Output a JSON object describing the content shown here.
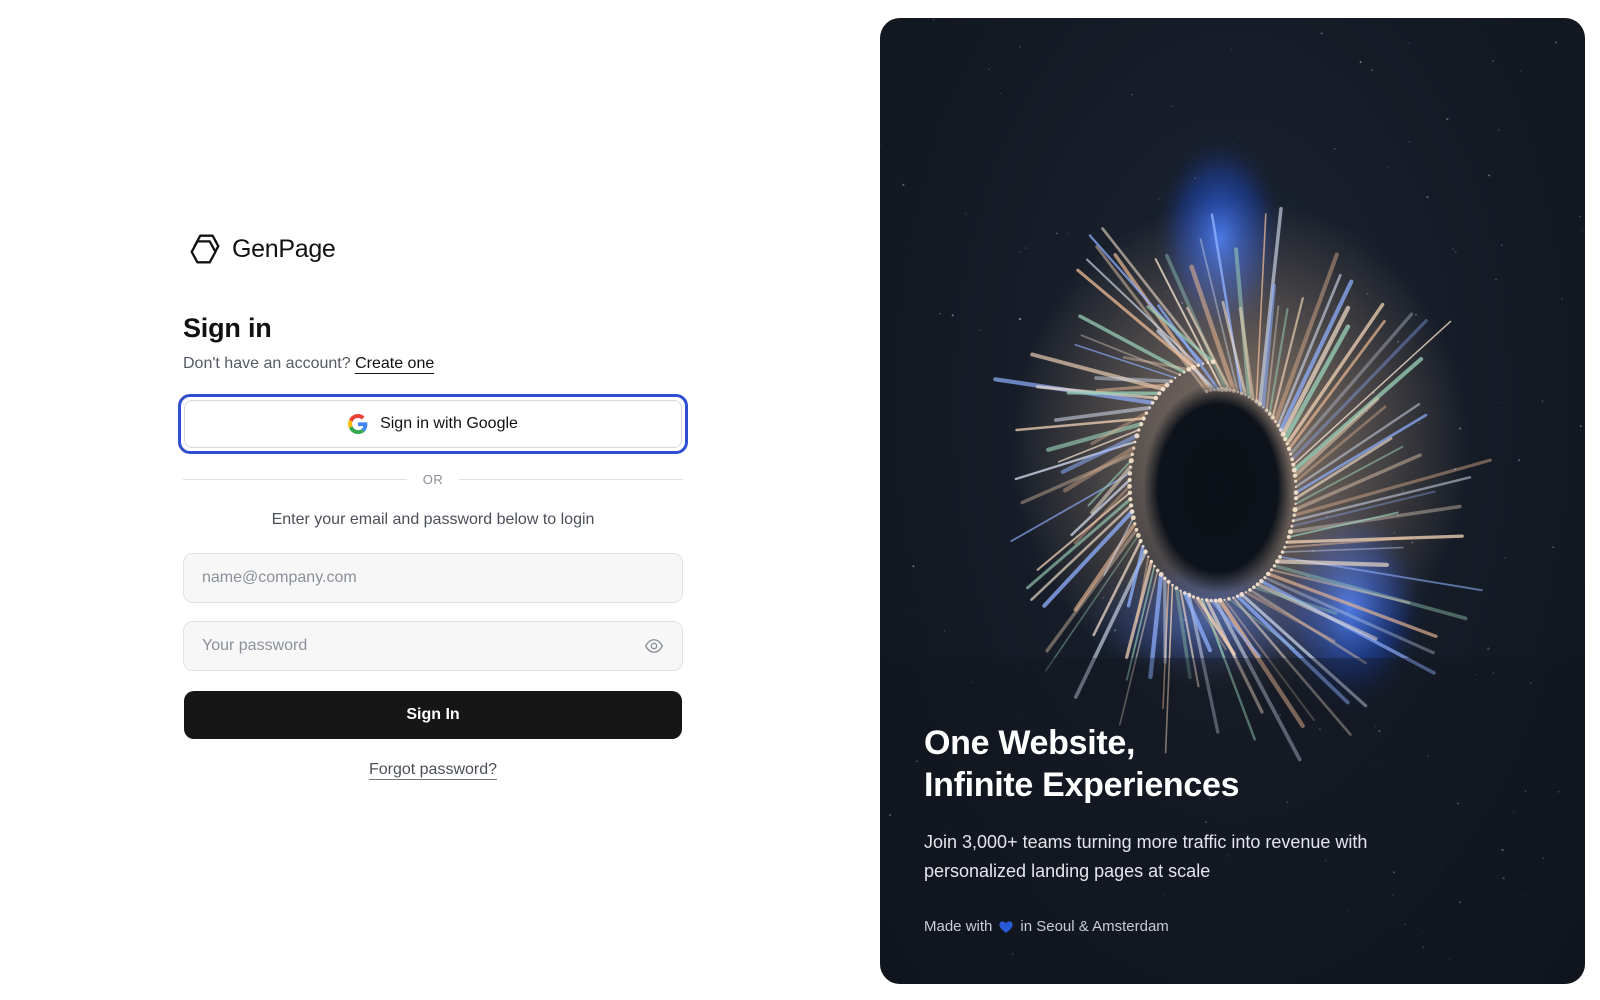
{
  "brand": {
    "name": "GenPage",
    "logo_icon": "genpage-logo-icon"
  },
  "form": {
    "title": "Sign in",
    "subtitle_prefix": "Don't have an account?",
    "create_link": "Create one",
    "google_button": "Sign in with Google",
    "google_icon": "google-icon",
    "divider": "OR",
    "helper": "Enter your email and password below to login",
    "email": {
      "placeholder": "name@company.com",
      "value": ""
    },
    "password": {
      "placeholder": "Your password",
      "value": "",
      "toggle_icon": "eye-icon"
    },
    "submit": "Sign In",
    "forgot": "Forgot password?"
  },
  "hero": {
    "title_line1": "One Website,",
    "title_line2": "Infinite Experiences",
    "subtitle": "Join 3,000+ teams turning more traffic into revenue with personalized landing pages at scale",
    "footer_prefix": "Made with",
    "footer_suffix": "in Seoul & Amsterdam",
    "heart_icon": "blue-heart-icon"
  },
  "colors": {
    "focus_ring": "#2f4fd0",
    "primary_button": "#161616",
    "hero_background": "#141a24",
    "heart": "#2a5bd7"
  }
}
